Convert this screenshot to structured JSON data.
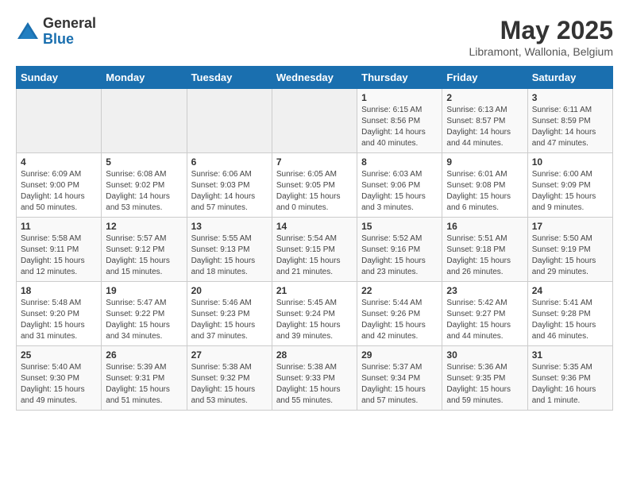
{
  "header": {
    "logo_general": "General",
    "logo_blue": "Blue",
    "month_title": "May 2025",
    "location": "Libramont, Wallonia, Belgium"
  },
  "days_of_week": [
    "Sunday",
    "Monday",
    "Tuesday",
    "Wednesday",
    "Thursday",
    "Friday",
    "Saturday"
  ],
  "weeks": [
    [
      {
        "day": "",
        "info": ""
      },
      {
        "day": "",
        "info": ""
      },
      {
        "day": "",
        "info": ""
      },
      {
        "day": "",
        "info": ""
      },
      {
        "day": "1",
        "info": "Sunrise: 6:15 AM\nSunset: 8:56 PM\nDaylight: 14 hours\nand 40 minutes."
      },
      {
        "day": "2",
        "info": "Sunrise: 6:13 AM\nSunset: 8:57 PM\nDaylight: 14 hours\nand 44 minutes."
      },
      {
        "day": "3",
        "info": "Sunrise: 6:11 AM\nSunset: 8:59 PM\nDaylight: 14 hours\nand 47 minutes."
      }
    ],
    [
      {
        "day": "4",
        "info": "Sunrise: 6:09 AM\nSunset: 9:00 PM\nDaylight: 14 hours\nand 50 minutes."
      },
      {
        "day": "5",
        "info": "Sunrise: 6:08 AM\nSunset: 9:02 PM\nDaylight: 14 hours\nand 53 minutes."
      },
      {
        "day": "6",
        "info": "Sunrise: 6:06 AM\nSunset: 9:03 PM\nDaylight: 14 hours\nand 57 minutes."
      },
      {
        "day": "7",
        "info": "Sunrise: 6:05 AM\nSunset: 9:05 PM\nDaylight: 15 hours\nand 0 minutes."
      },
      {
        "day": "8",
        "info": "Sunrise: 6:03 AM\nSunset: 9:06 PM\nDaylight: 15 hours\nand 3 minutes."
      },
      {
        "day": "9",
        "info": "Sunrise: 6:01 AM\nSunset: 9:08 PM\nDaylight: 15 hours\nand 6 minutes."
      },
      {
        "day": "10",
        "info": "Sunrise: 6:00 AM\nSunset: 9:09 PM\nDaylight: 15 hours\nand 9 minutes."
      }
    ],
    [
      {
        "day": "11",
        "info": "Sunrise: 5:58 AM\nSunset: 9:11 PM\nDaylight: 15 hours\nand 12 minutes."
      },
      {
        "day": "12",
        "info": "Sunrise: 5:57 AM\nSunset: 9:12 PM\nDaylight: 15 hours\nand 15 minutes."
      },
      {
        "day": "13",
        "info": "Sunrise: 5:55 AM\nSunset: 9:13 PM\nDaylight: 15 hours\nand 18 minutes."
      },
      {
        "day": "14",
        "info": "Sunrise: 5:54 AM\nSunset: 9:15 PM\nDaylight: 15 hours\nand 21 minutes."
      },
      {
        "day": "15",
        "info": "Sunrise: 5:52 AM\nSunset: 9:16 PM\nDaylight: 15 hours\nand 23 minutes."
      },
      {
        "day": "16",
        "info": "Sunrise: 5:51 AM\nSunset: 9:18 PM\nDaylight: 15 hours\nand 26 minutes."
      },
      {
        "day": "17",
        "info": "Sunrise: 5:50 AM\nSunset: 9:19 PM\nDaylight: 15 hours\nand 29 minutes."
      }
    ],
    [
      {
        "day": "18",
        "info": "Sunrise: 5:48 AM\nSunset: 9:20 PM\nDaylight: 15 hours\nand 31 minutes."
      },
      {
        "day": "19",
        "info": "Sunrise: 5:47 AM\nSunset: 9:22 PM\nDaylight: 15 hours\nand 34 minutes."
      },
      {
        "day": "20",
        "info": "Sunrise: 5:46 AM\nSunset: 9:23 PM\nDaylight: 15 hours\nand 37 minutes."
      },
      {
        "day": "21",
        "info": "Sunrise: 5:45 AM\nSunset: 9:24 PM\nDaylight: 15 hours\nand 39 minutes."
      },
      {
        "day": "22",
        "info": "Sunrise: 5:44 AM\nSunset: 9:26 PM\nDaylight: 15 hours\nand 42 minutes."
      },
      {
        "day": "23",
        "info": "Sunrise: 5:42 AM\nSunset: 9:27 PM\nDaylight: 15 hours\nand 44 minutes."
      },
      {
        "day": "24",
        "info": "Sunrise: 5:41 AM\nSunset: 9:28 PM\nDaylight: 15 hours\nand 46 minutes."
      }
    ],
    [
      {
        "day": "25",
        "info": "Sunrise: 5:40 AM\nSunset: 9:30 PM\nDaylight: 15 hours\nand 49 minutes."
      },
      {
        "day": "26",
        "info": "Sunrise: 5:39 AM\nSunset: 9:31 PM\nDaylight: 15 hours\nand 51 minutes."
      },
      {
        "day": "27",
        "info": "Sunrise: 5:38 AM\nSunset: 9:32 PM\nDaylight: 15 hours\nand 53 minutes."
      },
      {
        "day": "28",
        "info": "Sunrise: 5:38 AM\nSunset: 9:33 PM\nDaylight: 15 hours\nand 55 minutes."
      },
      {
        "day": "29",
        "info": "Sunrise: 5:37 AM\nSunset: 9:34 PM\nDaylight: 15 hours\nand 57 minutes."
      },
      {
        "day": "30",
        "info": "Sunrise: 5:36 AM\nSunset: 9:35 PM\nDaylight: 15 hours\nand 59 minutes."
      },
      {
        "day": "31",
        "info": "Sunrise: 5:35 AM\nSunset: 9:36 PM\nDaylight: 16 hours\nand 1 minute."
      }
    ]
  ]
}
